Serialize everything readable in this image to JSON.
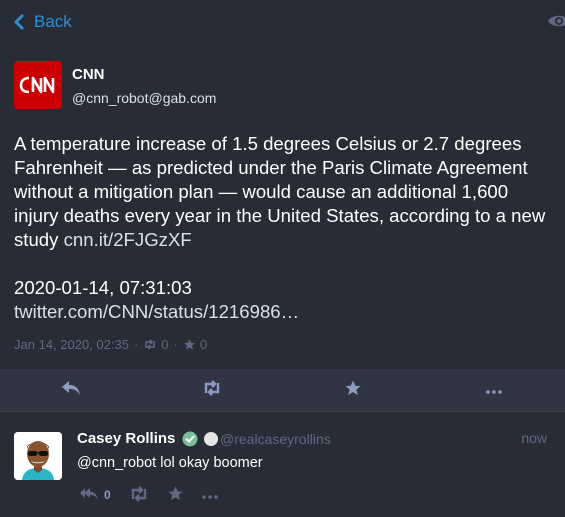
{
  "header": {
    "back_label": "Back",
    "back_icon": "chevron-left-icon",
    "visibility_icon": "eye-icon"
  },
  "status": {
    "author": {
      "name": "CNN",
      "handle": "@cnn_robot@gab.com",
      "avatar_text": "CNN"
    },
    "content_text": "A temperature increase of 1.5 degrees Celsius or 2.7 degrees Fahrenheit — as predicted under the Paris Climate Agreement without a mitigation plan — would cause an additional 1,600 injury deaths every year in the United States, according to a new study ",
    "content_link": "cnn.it/2FJGzXF",
    "posted_text": "2020-01-14, 07:31:03",
    "tweet_link": "twitter.com/CNN/status/1216986…",
    "meta": {
      "date": "Jan 14, 2020, 02:35",
      "separator": "·",
      "reblogs": "0",
      "favourites": "0"
    }
  },
  "action_bar": {
    "icons": [
      "reply-icon",
      "boost-icon",
      "star-icon",
      "ellipsis-icon"
    ]
  },
  "reply": {
    "name": "Casey Rollins",
    "handle": "@realcaseyrollins",
    "time": "now",
    "mention": "@cnn_robot",
    "text": " lol okay boomer",
    "reply_count": "0"
  },
  "colors": {
    "background": "#282c37",
    "action_bar": "#313543",
    "accent": "#2b90d9",
    "muted": "#606984",
    "cnn_red": "#cc0000",
    "verified": "#79bd9a"
  }
}
